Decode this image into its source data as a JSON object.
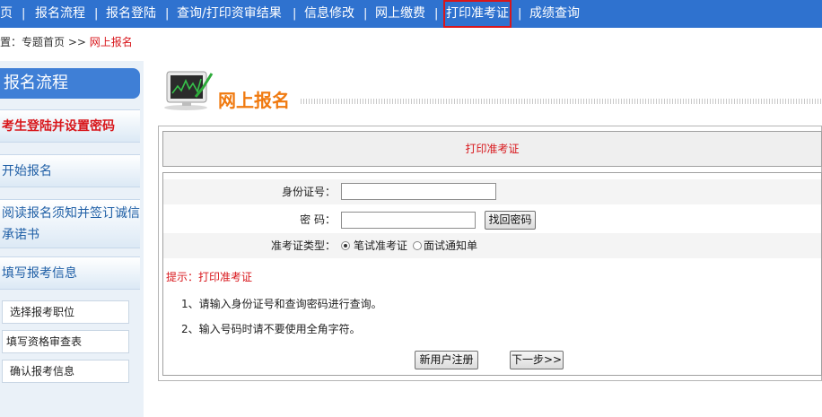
{
  "nav": {
    "items": [
      "页",
      "报名流程",
      "报名登陆",
      "查询/打印资审结果",
      "信息修改",
      "网上缴费",
      "打印准考证",
      "成绩查询"
    ],
    "separator": "|",
    "active_index": 6
  },
  "breadcrumb": {
    "prefix": "置：专题首页 >> ",
    "current": "网上报名"
  },
  "sidebar": {
    "title": "报名流程",
    "items": [
      "考生登陆并设置密码",
      "开始报名",
      "阅读报名须知并签订诚信承诺书",
      "填写报考信息"
    ],
    "subitems": [
      "选择报考职位",
      "填写资格审查表",
      "确认报考信息"
    ]
  },
  "main": {
    "title": "网上报名",
    "section_title": "打印准考证",
    "form": {
      "id_label": "身份证号：",
      "password_label": "密 码：",
      "recover_button": "找回密码",
      "type_label": "准考证类型：",
      "type_options": [
        "笔试准考证",
        "面试通知单"
      ],
      "type_selected": "笔试准考证",
      "id_value": "",
      "password_value": ""
    },
    "tip": "提示：打印准考证",
    "notes": [
      "1、请输入身份证号和查询密码进行查询。",
      "2、输入号码时请不要使用全角字符。"
    ],
    "register_button": "新用户注册",
    "next_button": "下一步>>"
  },
  "colors": {
    "nav_bg": "#2f72cf",
    "accent_red": "#d8161b",
    "title_orange": "#f07a10"
  }
}
